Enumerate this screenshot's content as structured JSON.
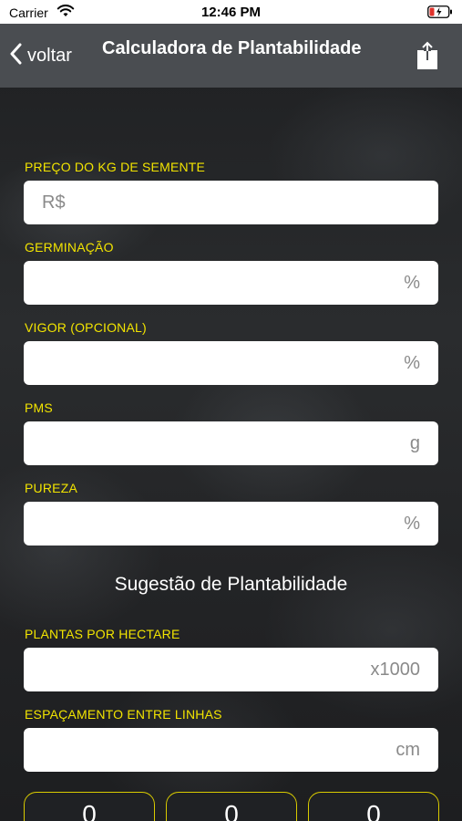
{
  "status_bar": {
    "carrier": "Carrier",
    "time": "12:46 PM"
  },
  "nav": {
    "back_label": "voltar",
    "title": "Calculadora de Plantabilidade"
  },
  "fields": [
    {
      "label": "PREÇO DO KG DE SEMENTE",
      "placeholder": "R$",
      "align": "left"
    },
    {
      "label": "GERMINAÇÃO",
      "placeholder": "%",
      "align": "right"
    },
    {
      "label": "VIGOR (OPCIONAL)",
      "placeholder": "%",
      "align": "right"
    },
    {
      "label": "PMS",
      "placeholder": "g",
      "align": "right"
    },
    {
      "label": "PUREZA",
      "placeholder": "%",
      "align": "right"
    }
  ],
  "suggestion": {
    "title": "Sugestão de Plantabilidade",
    "fields": [
      {
        "label": "PLANTAS POR HECTARE",
        "placeholder": "x1000"
      },
      {
        "label": "ESPAÇAMENTO ENTRE LINHAS",
        "placeholder": "cm"
      }
    ]
  },
  "results": [
    "0",
    "0",
    "0"
  ],
  "colors": {
    "accent_yellow": "#f2e400",
    "nav_bg": "#4a4d51",
    "field_bg": "#ffffff"
  },
  "icons": {
    "wifi": "wifi-icon",
    "battery": "battery-charging-icon",
    "back": "chevron-left-icon",
    "share": "share-icon"
  }
}
